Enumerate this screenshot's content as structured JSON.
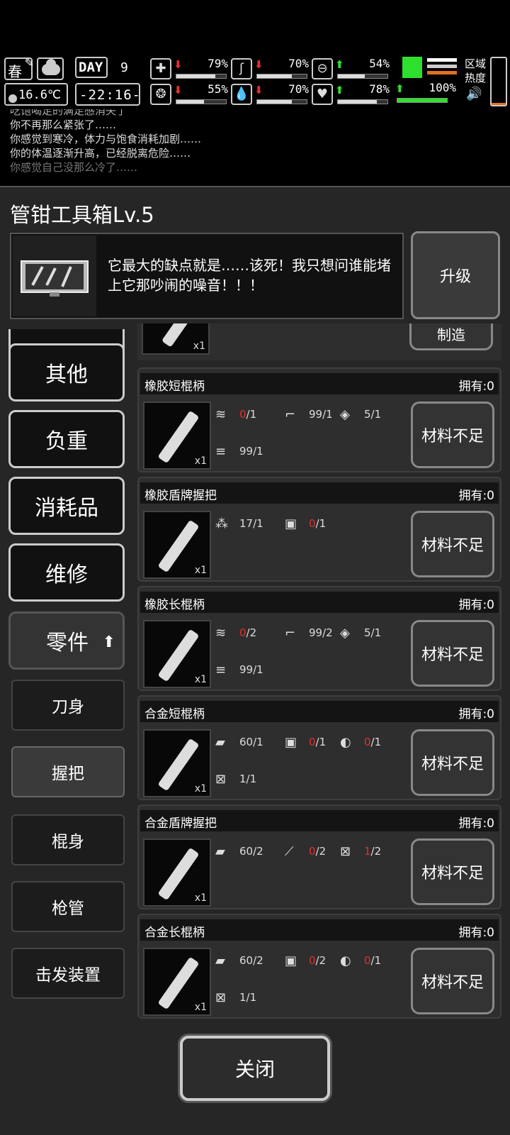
{
  "status": {
    "season": "春",
    "temperature": "16.6℃",
    "day_label": "DAY",
    "day_number": "9",
    "clock": "-22:16-",
    "stats": [
      {
        "name": "health",
        "icon": "medkit-icon",
        "glyph": "✚",
        "trend": "down",
        "percent": "79%",
        "level": 0.79
      },
      {
        "name": "hunger",
        "icon": "stomach-icon",
        "glyph": "ʃ",
        "trend": "down",
        "percent": "70%",
        "level": 0.7
      },
      {
        "name": "stamina",
        "icon": "capsule-icon",
        "glyph": "⊖",
        "trend": "up",
        "percent": "54%",
        "level": 0.54
      },
      {
        "name": "sanity",
        "icon": "brain-icon",
        "glyph": "❂",
        "trend": "down",
        "percent": "55%",
        "level": 0.55
      },
      {
        "name": "thirst",
        "icon": "water-drop-icon",
        "glyph": "💧",
        "trend": "down",
        "percent": "70%",
        "level": 0.7
      },
      {
        "name": "mood",
        "icon": "heart-icon",
        "glyph": "♥",
        "trend": "up",
        "percent": "78%",
        "level": 0.78
      }
    ],
    "boots": {
      "trend": "up",
      "percent": "100%",
      "level": 1.0
    },
    "zone_heat_label_1": "区域",
    "zone_heat_label_2": "热度",
    "zone_heat_level": 0.04,
    "colors": {
      "up": "#2ee02e",
      "down": "#e03030",
      "accent": "#e07020"
    }
  },
  "log": [
    "吃饱喝足的满足感消失了",
    "你不再那么紧张了……",
    "你感觉到寒冷，体力与饱食消耗加剧……",
    "你的体温逐渐升高，已经脱离危险……",
    "你感觉自己没那么冷了……"
  ],
  "panel": {
    "title": "管钳工具箱Lv.5",
    "description": "它最大的缺点就是……该死！我只想问谁能堵上它那吵闹的噪音！！！",
    "upgrade_label": "升级",
    "top_craft_label": "制造",
    "categories": [
      "其他",
      "负重",
      "消耗品",
      "维修"
    ],
    "active_category": "零件",
    "subcategories": [
      "刀身",
      "握把",
      "棍身",
      "枪管",
      "击发装置"
    ],
    "selected_subcategory": "握把",
    "close_label": "关闭",
    "recipes": [
      {
        "name": "橡胶短棍柄",
        "owned": "拥有:0",
        "qty": "x1",
        "button": "材料不足",
        "materials": [
          {
            "icon": "rubber-coil-icon",
            "glyph": "≋",
            "have": "0",
            "need": "/1",
            "short": true
          },
          {
            "icon": "pipe-icon",
            "glyph": "⌐",
            "have": "99",
            "need": "/1",
            "short": false
          },
          {
            "icon": "cloth-icon",
            "glyph": "◈",
            "have": "5",
            "need": "/1",
            "short": false
          },
          {
            "icon": "log-bundle-icon",
            "glyph": "≡",
            "have": "99",
            "need": "/1",
            "short": false
          }
        ]
      },
      {
        "name": "橡胶盾牌握把",
        "owned": "拥有:0",
        "qty": "x1",
        "button": "材料不足",
        "materials": [
          {
            "icon": "debris-icon",
            "glyph": "⁂",
            "have": "17",
            "need": "/1",
            "short": false
          },
          {
            "icon": "jerrycan-icon",
            "glyph": "▣",
            "have": "0",
            "need": "/1",
            "short": true
          }
        ]
      },
      {
        "name": "橡胶长棍柄",
        "owned": "拥有:0",
        "qty": "x1",
        "button": "材料不足",
        "materials": [
          {
            "icon": "rubber-coil-icon",
            "glyph": "≋",
            "have": "0",
            "need": "/2",
            "short": true
          },
          {
            "icon": "pipe-icon",
            "glyph": "⌐",
            "have": "99",
            "need": "/2",
            "short": false
          },
          {
            "icon": "cloth-icon",
            "glyph": "◈",
            "have": "5",
            "need": "/1",
            "short": false
          },
          {
            "icon": "log-bundle-icon",
            "glyph": "≡",
            "have": "99",
            "need": "/1",
            "short": false
          }
        ]
      },
      {
        "name": "合金短棍柄",
        "owned": "拥有:0",
        "qty": "x1",
        "button": "材料不足",
        "materials": [
          {
            "icon": "metal-plate-icon",
            "glyph": "▰",
            "have": "60",
            "need": "/1",
            "short": false
          },
          {
            "icon": "jerrycan-icon",
            "glyph": "▣",
            "have": "0",
            "need": "/1",
            "short": true
          },
          {
            "icon": "tape-roll-icon",
            "glyph": "◐",
            "have": "0",
            "need": "/1",
            "short": true
          },
          {
            "icon": "toolbox-icon",
            "glyph": "⊠",
            "have": "1",
            "need": "/1",
            "short": false
          }
        ]
      },
      {
        "name": "合金盾牌握把",
        "owned": "拥有:0",
        "qty": "x1",
        "button": "材料不足",
        "materials": [
          {
            "icon": "metal-plate-icon",
            "glyph": "▰",
            "have": "60",
            "need": "/2",
            "short": false
          },
          {
            "icon": "glue-tube-icon",
            "glyph": "⟋",
            "have": "0",
            "need": "/2",
            "short": true
          },
          {
            "icon": "toolbox-icon",
            "glyph": "⊠",
            "have": "1",
            "need": "/2",
            "short": true
          }
        ]
      },
      {
        "name": "合金长棍柄",
        "owned": "拥有:0",
        "qty": "x1",
        "button": "材料不足",
        "materials": [
          {
            "icon": "metal-plate-icon",
            "glyph": "▰",
            "have": "60",
            "need": "/2",
            "short": false
          },
          {
            "icon": "jerrycan-icon",
            "glyph": "▣",
            "have": "0",
            "need": "/2",
            "short": true
          },
          {
            "icon": "tape-roll-icon",
            "glyph": "◐",
            "have": "0",
            "need": "/1",
            "short": true
          },
          {
            "icon": "toolbox-icon",
            "glyph": "⊠",
            "have": "1",
            "need": "/1",
            "short": false
          }
        ]
      }
    ]
  }
}
